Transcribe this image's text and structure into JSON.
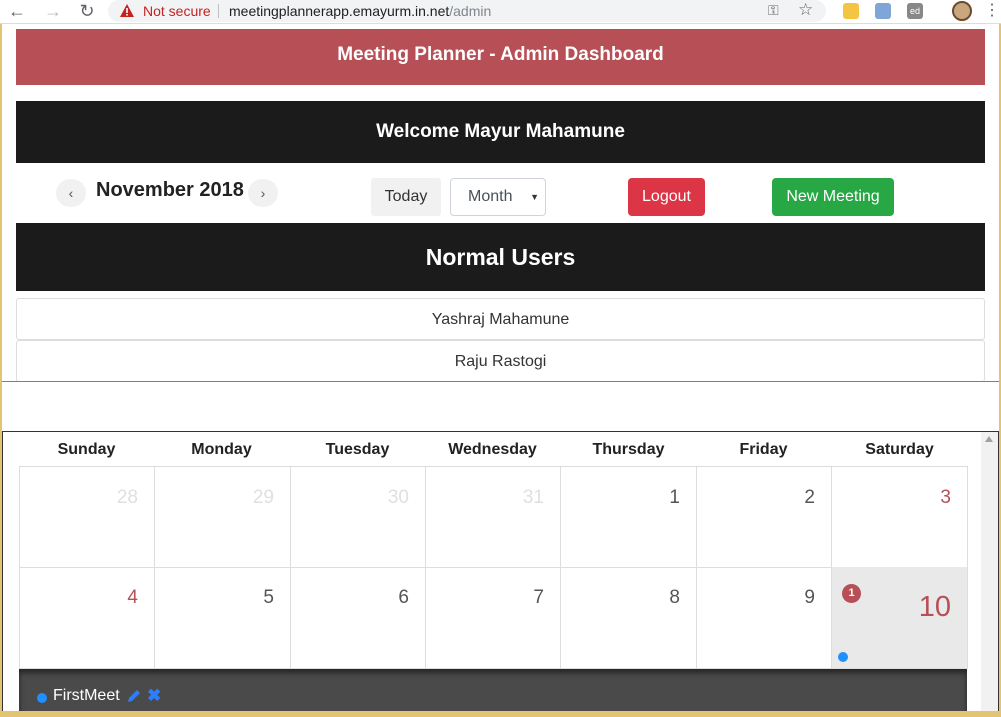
{
  "browser": {
    "security_label": "Not secure",
    "url_host": "meetingplannerapp.emayurm.in.net",
    "url_path": "/admin",
    "ext_label": "ed"
  },
  "header": {
    "title": "Meeting Planner - Admin Dashboard",
    "welcome": "Welcome Mayur Mahamune"
  },
  "toolbar": {
    "prev": "‹",
    "next": "›",
    "month_label": "November 2018",
    "today_label": "Today",
    "view_select": "Month",
    "logout_label": "Logout",
    "new_meeting_label": "New Meeting"
  },
  "users": {
    "heading": "Normal Users",
    "items": [
      "Yashraj Mahamune",
      "Raju Rastogi"
    ]
  },
  "calendar": {
    "days": [
      "Sunday",
      "Monday",
      "Tuesday",
      "Wednesday",
      "Thursday",
      "Friday",
      "Saturday"
    ],
    "week1": [
      "28",
      "29",
      "30",
      "31",
      "1",
      "2",
      "3"
    ],
    "week2": [
      "4",
      "5",
      "6",
      "7",
      "8",
      "9",
      "10"
    ],
    "today_event_count": "1",
    "open_event": {
      "title": "FirstMeet",
      "dot_color": "#1e90ff"
    }
  },
  "colors": {
    "brand": "#b64f56",
    "dark": "#1b1b1b",
    "danger": "#dc3545",
    "success": "#28a745"
  }
}
